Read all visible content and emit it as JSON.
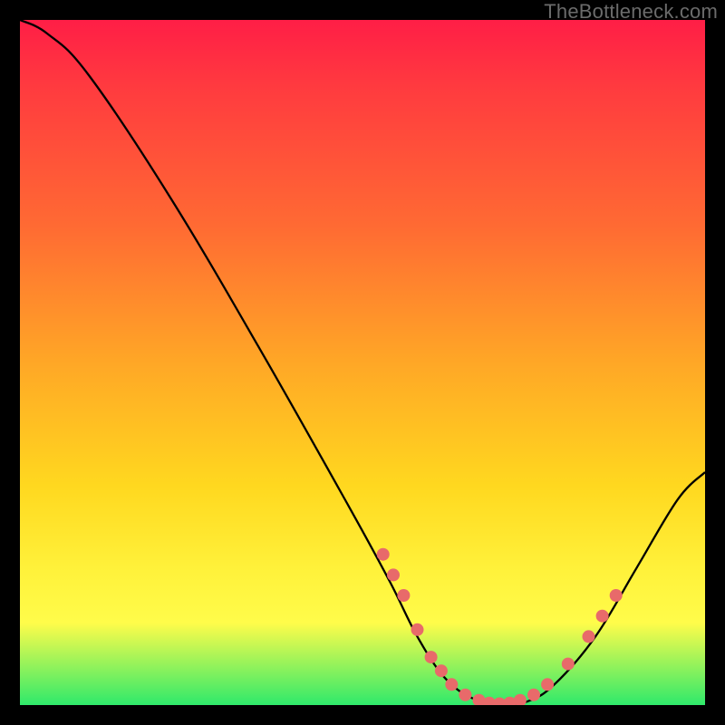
{
  "attribution": "TheBottleneck.com",
  "chart_data": {
    "type": "line",
    "title": "",
    "xlabel": "",
    "ylabel": "",
    "x_range": [
      0,
      100
    ],
    "y_range": [
      0,
      100
    ],
    "curve": [
      {
        "x": 0,
        "y": 100
      },
      {
        "x": 4,
        "y": 98
      },
      {
        "x": 10,
        "y": 92
      },
      {
        "x": 22,
        "y": 74
      },
      {
        "x": 35,
        "y": 52
      },
      {
        "x": 48,
        "y": 29
      },
      {
        "x": 54,
        "y": 18
      },
      {
        "x": 58,
        "y": 10
      },
      {
        "x": 62,
        "y": 4
      },
      {
        "x": 66,
        "y": 1
      },
      {
        "x": 70,
        "y": 0
      },
      {
        "x": 74,
        "y": 0.5
      },
      {
        "x": 78,
        "y": 3
      },
      {
        "x": 84,
        "y": 10
      },
      {
        "x": 90,
        "y": 20
      },
      {
        "x": 96,
        "y": 30
      },
      {
        "x": 100,
        "y": 34
      }
    ],
    "markers": [
      {
        "x": 53,
        "y": 22
      },
      {
        "x": 54.5,
        "y": 19
      },
      {
        "x": 56,
        "y": 16
      },
      {
        "x": 58,
        "y": 11
      },
      {
        "x": 60,
        "y": 7
      },
      {
        "x": 61.5,
        "y": 5
      },
      {
        "x": 63,
        "y": 3
      },
      {
        "x": 65,
        "y": 1.5
      },
      {
        "x": 67,
        "y": 0.7
      },
      {
        "x": 68.5,
        "y": 0.3
      },
      {
        "x": 70,
        "y": 0.2
      },
      {
        "x": 71.5,
        "y": 0.3
      },
      {
        "x": 73,
        "y": 0.7
      },
      {
        "x": 75,
        "y": 1.5
      },
      {
        "x": 77,
        "y": 3
      },
      {
        "x": 80,
        "y": 6
      },
      {
        "x": 83,
        "y": 10
      },
      {
        "x": 85,
        "y": 13
      },
      {
        "x": 87,
        "y": 16
      }
    ],
    "marker_color": "#e86a6a",
    "gradient_stops": [
      {
        "pos": 0.0,
        "color": "#ff1e46"
      },
      {
        "pos": 0.1,
        "color": "#ff3b3f"
      },
      {
        "pos": 0.3,
        "color": "#ff6a33"
      },
      {
        "pos": 0.5,
        "color": "#ffa726"
      },
      {
        "pos": 0.68,
        "color": "#ffd81f"
      },
      {
        "pos": 0.8,
        "color": "#fff13a"
      },
      {
        "pos": 0.88,
        "color": "#fffc4a"
      },
      {
        "pos": 1.0,
        "color": "#2fe96b"
      }
    ]
  }
}
